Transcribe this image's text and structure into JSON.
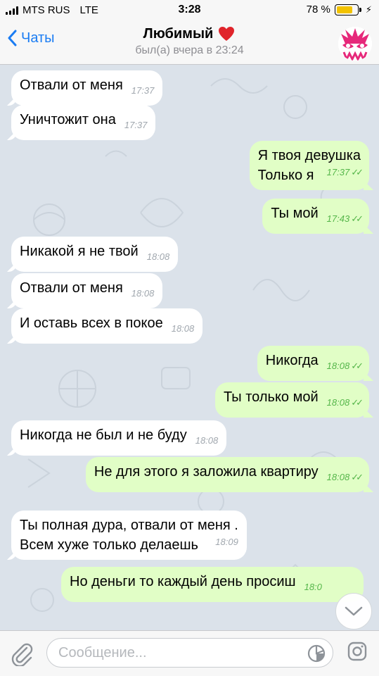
{
  "status_bar": {
    "carrier": "MTS RUS",
    "network": "LTE",
    "time": "3:28",
    "battery": "78 %",
    "battery_level": 0.78,
    "battery_color": "#f2c200"
  },
  "header": {
    "back_label": "Чаты",
    "contact_name": "Любимый",
    "name_emoji": "❤️",
    "last_seen": "был(а) вчера в 23:24",
    "accent_color": "#1a7cf3"
  },
  "messages": [
    {
      "dir": "in",
      "text": "Отвали от меня",
      "time": "17:37"
    },
    {
      "dir": "in",
      "text": "Уничтожит она",
      "time": "17:37"
    },
    {
      "dir": "out",
      "text": "Я твоя девушка\nТолько я",
      "time": "17:37",
      "read": true
    },
    {
      "dir": "out",
      "text": "Ты мой",
      "time": "17:43",
      "read": true
    },
    {
      "dir": "in",
      "text": "Никакой я не твой",
      "time": "18:08"
    },
    {
      "dir": "in",
      "text": "Отвали от меня",
      "time": "18:08"
    },
    {
      "dir": "in",
      "text": "И оставь всех в покое",
      "time": "18:08"
    },
    {
      "dir": "out",
      "text": "Никогда",
      "time": "18:08",
      "read": true
    },
    {
      "dir": "out",
      "text": "Ты только мой",
      "time": "18:08",
      "read": true
    },
    {
      "dir": "in",
      "text": "Никогда не был и не буду",
      "time": "18:08"
    },
    {
      "dir": "out",
      "text": "Не для этого я заложила квартиру",
      "time": "18:08",
      "read": true
    },
    {
      "dir": "in",
      "text": "Ты полная дура, отвали от меня .\nВсем хуже только делаешь",
      "time": "18:09"
    },
    {
      "dir": "out",
      "text": "Но деньги то каждый день просиш",
      "time": "18:0",
      "read": false
    }
  ],
  "input": {
    "placeholder": "Сообщение..."
  },
  "icons": {
    "back": "chevron-left-icon",
    "attach": "paperclip-icon",
    "sticker": "sticker-icon",
    "camera": "instagram-camera-icon",
    "scroll": "chevron-down-icon"
  },
  "colors": {
    "incoming_bubble": "#ffffff",
    "outgoing_bubble": "#e1fec6",
    "read_ticks": "#55b64a",
    "chat_background": "#dbe2ea"
  }
}
